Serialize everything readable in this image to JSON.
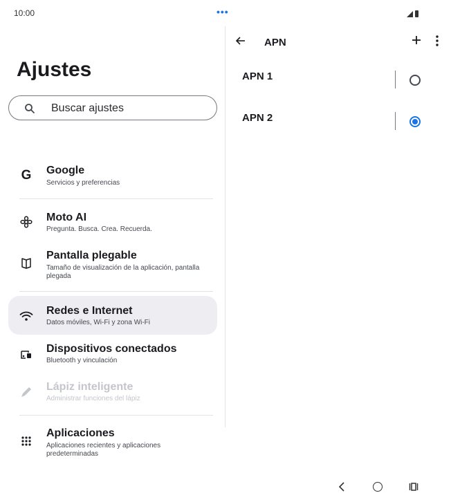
{
  "status_bar": {
    "time": "10:00",
    "dots": "•••"
  },
  "settings": {
    "title": "Ajustes",
    "search": {
      "placeholder": "Buscar ajustes"
    },
    "items": [
      {
        "title": "Google",
        "subtitle": "Servicios y preferencias",
        "icon": "google-icon"
      },
      {
        "title": "Moto AI",
        "subtitle": "Pregunta. Busca. Crea. Recuerda.",
        "icon": "moto-ai-icon"
      },
      {
        "title": "Pantalla plegable",
        "subtitle": "Tamaño de visualización de la aplicación, pantalla plegada",
        "icon": "foldable-display-icon"
      },
      {
        "title": "Redes e Internet",
        "subtitle": "Datos móviles, Wi-Fi y zona Wi-Fi",
        "icon": "wifi-icon",
        "selected": true
      },
      {
        "title": "Dispositivos conectados",
        "subtitle": "Bluetooth y vinculación",
        "icon": "connected-devices-icon"
      },
      {
        "title": "Lápiz inteligente",
        "subtitle": "Administrar funciones del lápiz",
        "icon": "pen-icon",
        "disabled": true
      },
      {
        "title": "Aplicaciones",
        "subtitle": "Aplicaciones recientes y aplicaciones predeterminadas",
        "icon": "apps-grid-icon"
      }
    ],
    "google_glyph": "G"
  },
  "apn": {
    "title": "APN",
    "entries": [
      {
        "name": "APN 1",
        "selected": false
      },
      {
        "name": "APN 2",
        "selected": true
      }
    ]
  },
  "colors": {
    "accent": "#1a73e8",
    "selected_bg": "#eeeef2",
    "disabled_text": "#c4c6cc"
  }
}
